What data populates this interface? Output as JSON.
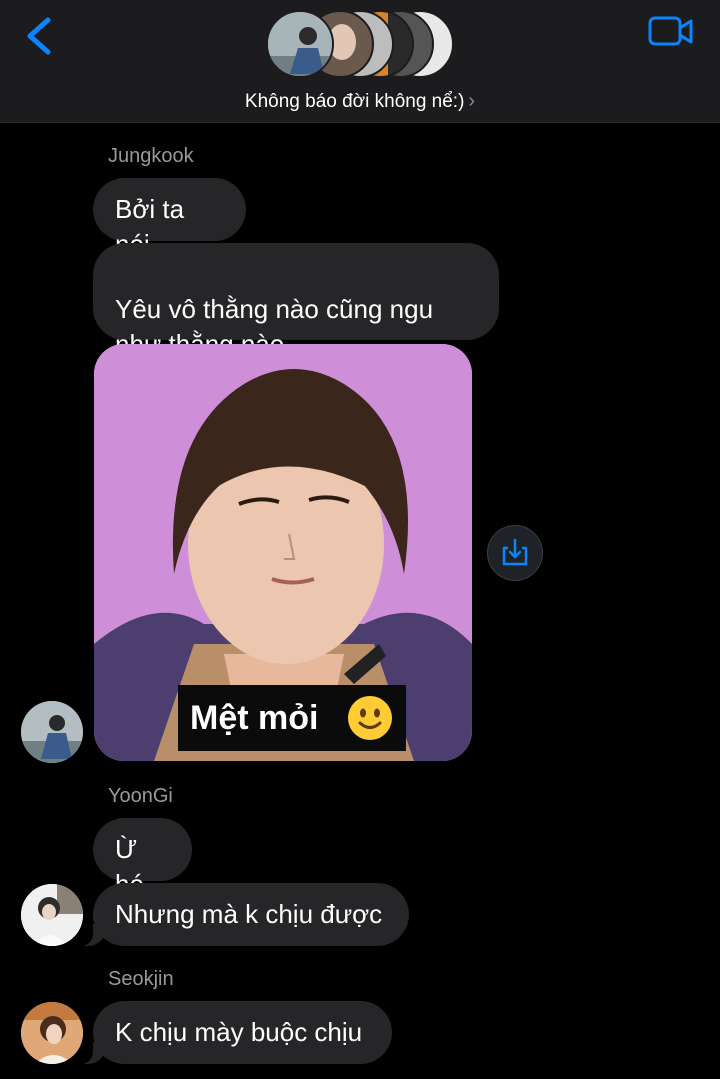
{
  "header": {
    "group_title": "Không báo đời không nể:)",
    "title_chevron": "›",
    "member_avatar_count": 6
  },
  "messages": [
    {
      "sender": "Jungkook",
      "texts": [
        "Bởi ta nói",
        "Yêu vô thằng nào cũng ngu\nnhư thằng nào"
      ]
    },
    {
      "image_caption": "Mệt mỏi",
      "image_emoji": "slightly-smiling-face"
    },
    {
      "sender": "YoonGi",
      "texts": [
        "Ừ hé",
        "Nhưng mà k chịu được"
      ]
    },
    {
      "sender": "Seokjin",
      "texts": [
        "K chịu mày buộc chịu"
      ]
    }
  ],
  "colors": {
    "accent": "#0a84ff",
    "bubble": "#262628",
    "header_bg": "#1c1c1e",
    "sender_name": "#98989f",
    "photo_bg": "#cf8fd8"
  }
}
